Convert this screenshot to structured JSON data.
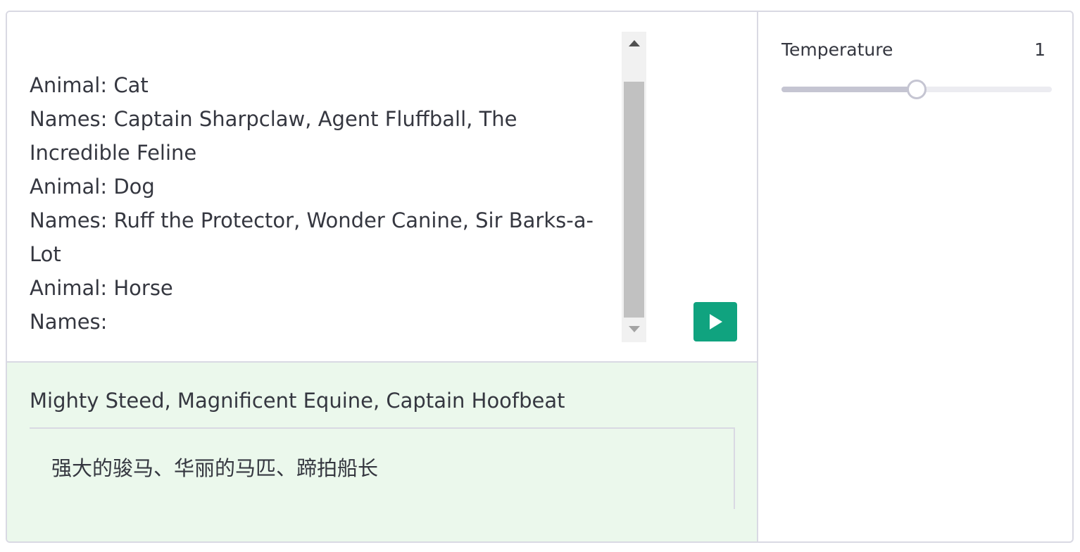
{
  "prompt": {
    "lines": [
      "Animal: Cat",
      "Names: Captain Sharpclaw, Agent Fluffball, The Incredible Feline",
      "Animal: Dog",
      "Names: Ruff the Protector, Wonder Canine, Sir Barks-a-Lot",
      "Animal: Horse",
      "Names:"
    ]
  },
  "run_button": {
    "icon": "play-icon",
    "color": "#10a37f"
  },
  "output": {
    "text": "Mighty Steed, Magnificent Equine, Captain Hoofbeat",
    "background_color": "#ebf8ec"
  },
  "translation": {
    "text": "强大的骏马、华丽的马匹、蹄拍船长"
  },
  "settings": {
    "temperature": {
      "label": "Temperature",
      "value": "1",
      "fraction": 0.5
    }
  }
}
